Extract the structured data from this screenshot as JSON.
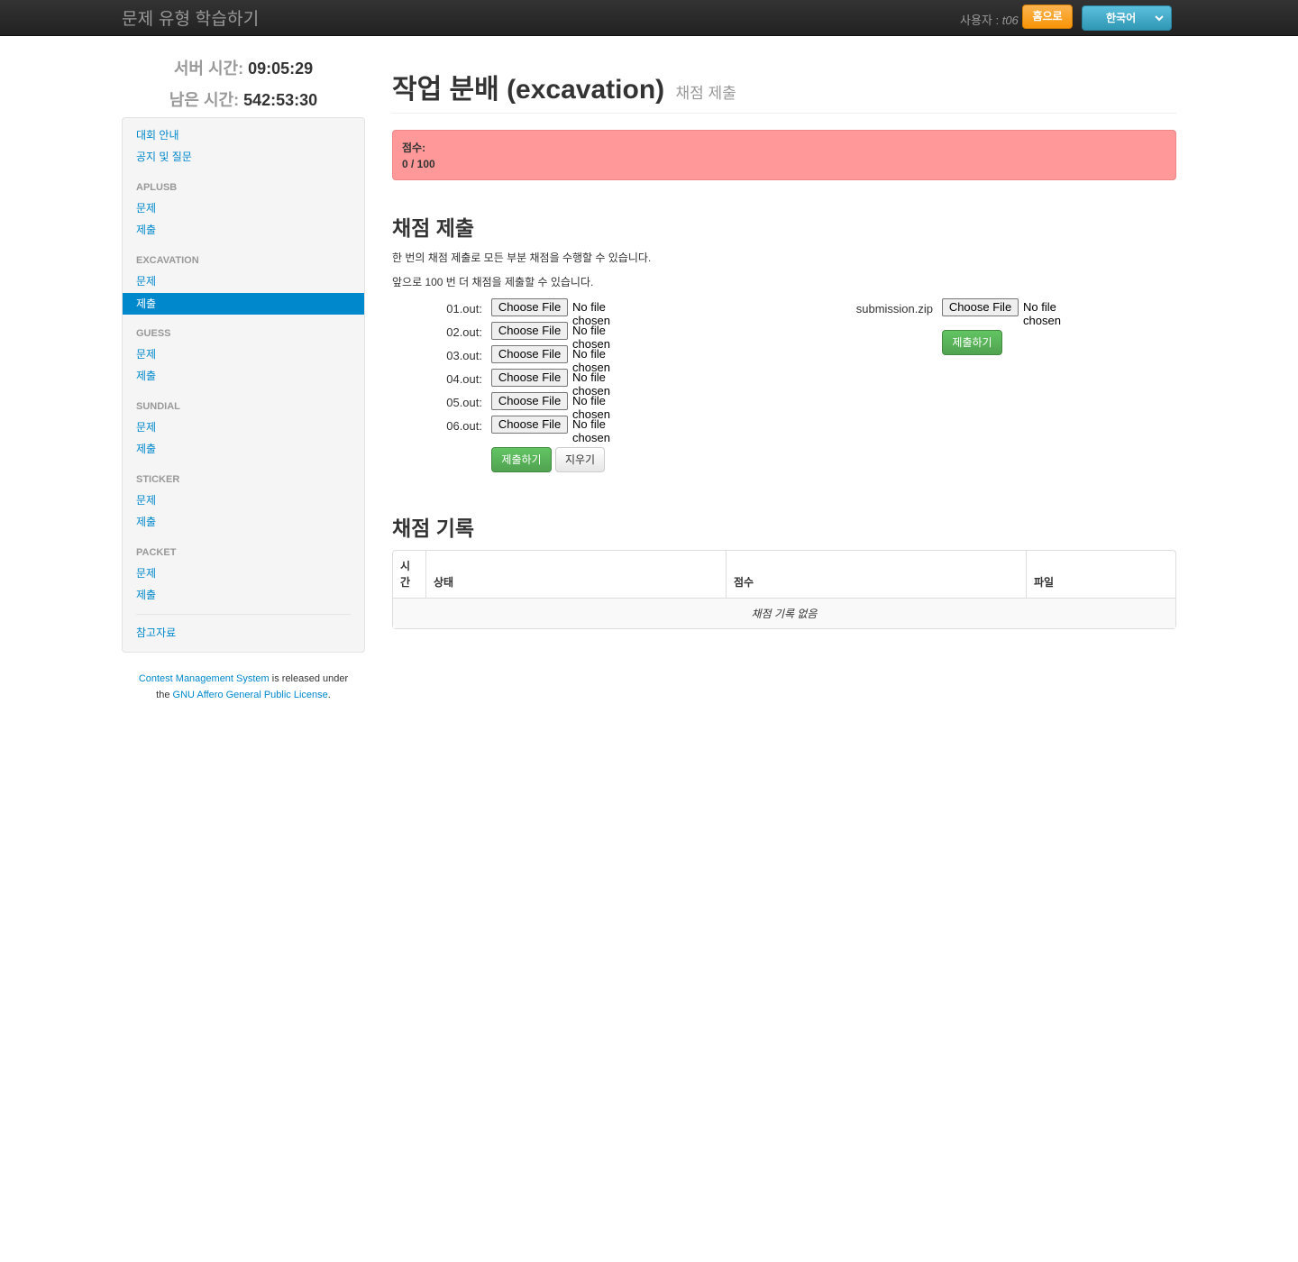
{
  "header": {
    "brand": "문제 유형 학습하기",
    "user_label": "사용자 : ",
    "user_name": "t06",
    "home_button": "홈으로",
    "language": "한국어"
  },
  "sidebar": {
    "server_time_label": "서버 시간:",
    "server_time_value": "09:05:29",
    "remaining_time_label": "남은 시간:",
    "remaining_time_value": "542:53:30",
    "general": [
      "대회 안내",
      "공지 및 질문"
    ],
    "tasks": [
      {
        "name": "APLUSB",
        "problem": "문제",
        "submit": "제출"
      },
      {
        "name": "EXCAVATION",
        "problem": "문제",
        "submit": "제출"
      },
      {
        "name": "GUESS",
        "problem": "문제",
        "submit": "제출"
      },
      {
        "name": "SUNDIAL",
        "problem": "문제",
        "submit": "제출"
      },
      {
        "name": "STICKER",
        "problem": "문제",
        "submit": "제출"
      },
      {
        "name": "PACKET",
        "problem": "문제",
        "submit": "제출"
      }
    ],
    "active_task": "EXCAVATION",
    "reference": "참고자료"
  },
  "footer": {
    "cms_link": "Contest Management System",
    "text_mid": " is released under",
    "text_the": "the ",
    "license_link": "GNU Affero General Public License",
    "text_end": "."
  },
  "main": {
    "title": "작업 분배 (excavation)",
    "subtitle": "채점 제출",
    "score_label": "점수:",
    "score_value": "0 / 100",
    "submit_heading": "채점 제출",
    "info_line1": "한 번의 채점 제출로 모든 부분 채점을 수행할 수 있습니다.",
    "info_line2": "앞으로 100 번 더 채점을 제출할 수 있습니다.",
    "files": [
      "01.out:",
      "02.out:",
      "03.out:",
      "04.out:",
      "05.out:",
      "06.out:"
    ],
    "choose_file": "Choose File",
    "no_file": "No file chosen",
    "submit_button": "제출하기",
    "reset_button": "지우기",
    "zip_label": "submission.zip",
    "zip_submit_button": "제출하기",
    "history_heading": "채점 기록",
    "history_columns": [
      "시간",
      "상태",
      "점수",
      "파일"
    ],
    "history_empty": "채점 기록 없음"
  }
}
